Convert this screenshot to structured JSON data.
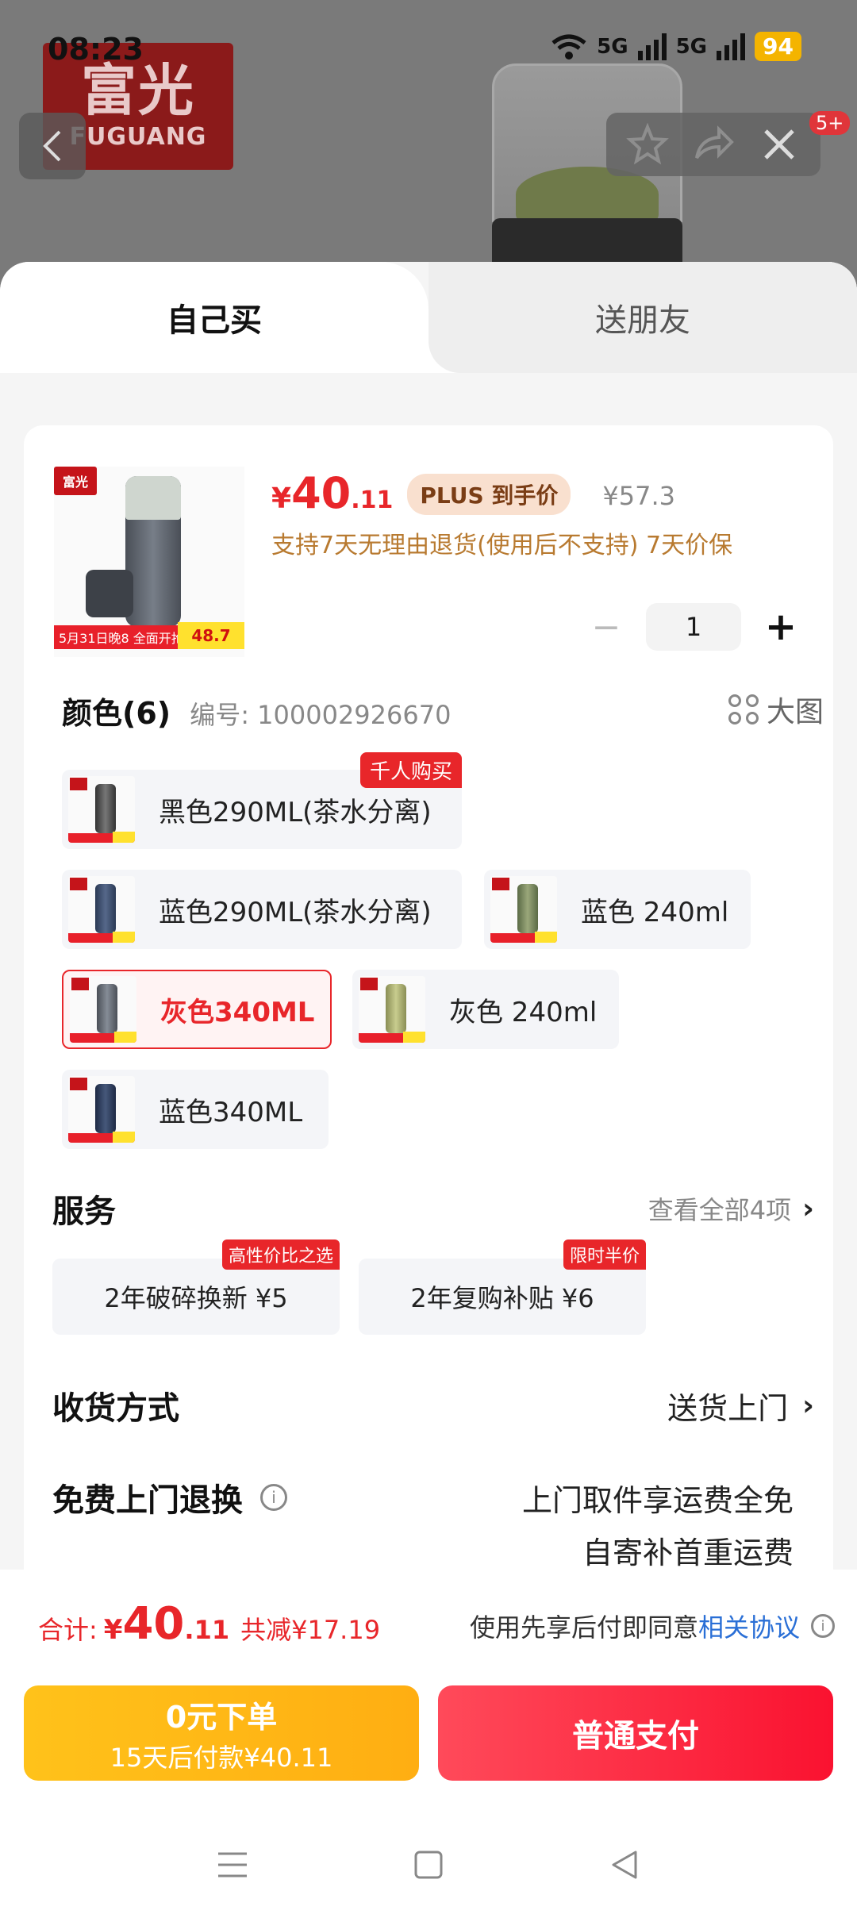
{
  "status_bar": {
    "time": "08:23",
    "signal1": "5G",
    "signal2": "5G",
    "battery": "94"
  },
  "background": {
    "brand_cn": "富光",
    "brand_en": "FUGUANG",
    "notification_count": "5+"
  },
  "tabs": {
    "self": "自己买",
    "gift": "送朋友"
  },
  "product": {
    "thumb_logo": "富光",
    "thumb_banner": "5月31日晚8 全面开抢",
    "thumb_price": "48.7",
    "price_currency": "¥",
    "price_int": "40",
    "price_dec": ".11",
    "plus_tag": "PLUS 到手价",
    "original_price": "¥57.3",
    "guarantee": "支持7天无理由退货(使用后不支持) 7天价保",
    "quantity": "1"
  },
  "colors": {
    "title": "颜色(6)",
    "sku": "编号: 100002926670",
    "big_image": "大图",
    "options": [
      {
        "label": "黑色290ML(茶水分离)",
        "tag": "千人购买"
      },
      {
        "label": "蓝色290ML(茶水分离)"
      },
      {
        "label": "蓝色 240ml"
      },
      {
        "label": "灰色340ML"
      },
      {
        "label": "灰色 240ml"
      },
      {
        "label": "蓝色340ML"
      }
    ]
  },
  "services": {
    "title": "服务",
    "link": "查看全部4项",
    "items": [
      {
        "label": "2年破碎换新 ¥5",
        "tag": "高性价比之选"
      },
      {
        "label": "2年复购补贴 ¥6",
        "tag": "限时半价"
      }
    ]
  },
  "delivery": {
    "title": "收货方式",
    "value": "送货上门"
  },
  "free_return": {
    "title": "免费上门退换",
    "line1": "上门取件享运费全免",
    "line2": "自寄补首重运费"
  },
  "bottom": {
    "total_label": "合计:",
    "total_currency": "¥",
    "total_int": "40",
    "total_dec": ".11",
    "discount": "共减¥17.19",
    "agree_prefix": "使用先享后付即同意",
    "agree_link": "相关协议",
    "zero_title": "0元下单",
    "zero_sub": "15天后付款¥40.11",
    "pay_label": "普通支付"
  },
  "colors_theme": {
    "accent": "#e8262a",
    "gold": "#ffae12",
    "link": "#2a6fd6"
  }
}
